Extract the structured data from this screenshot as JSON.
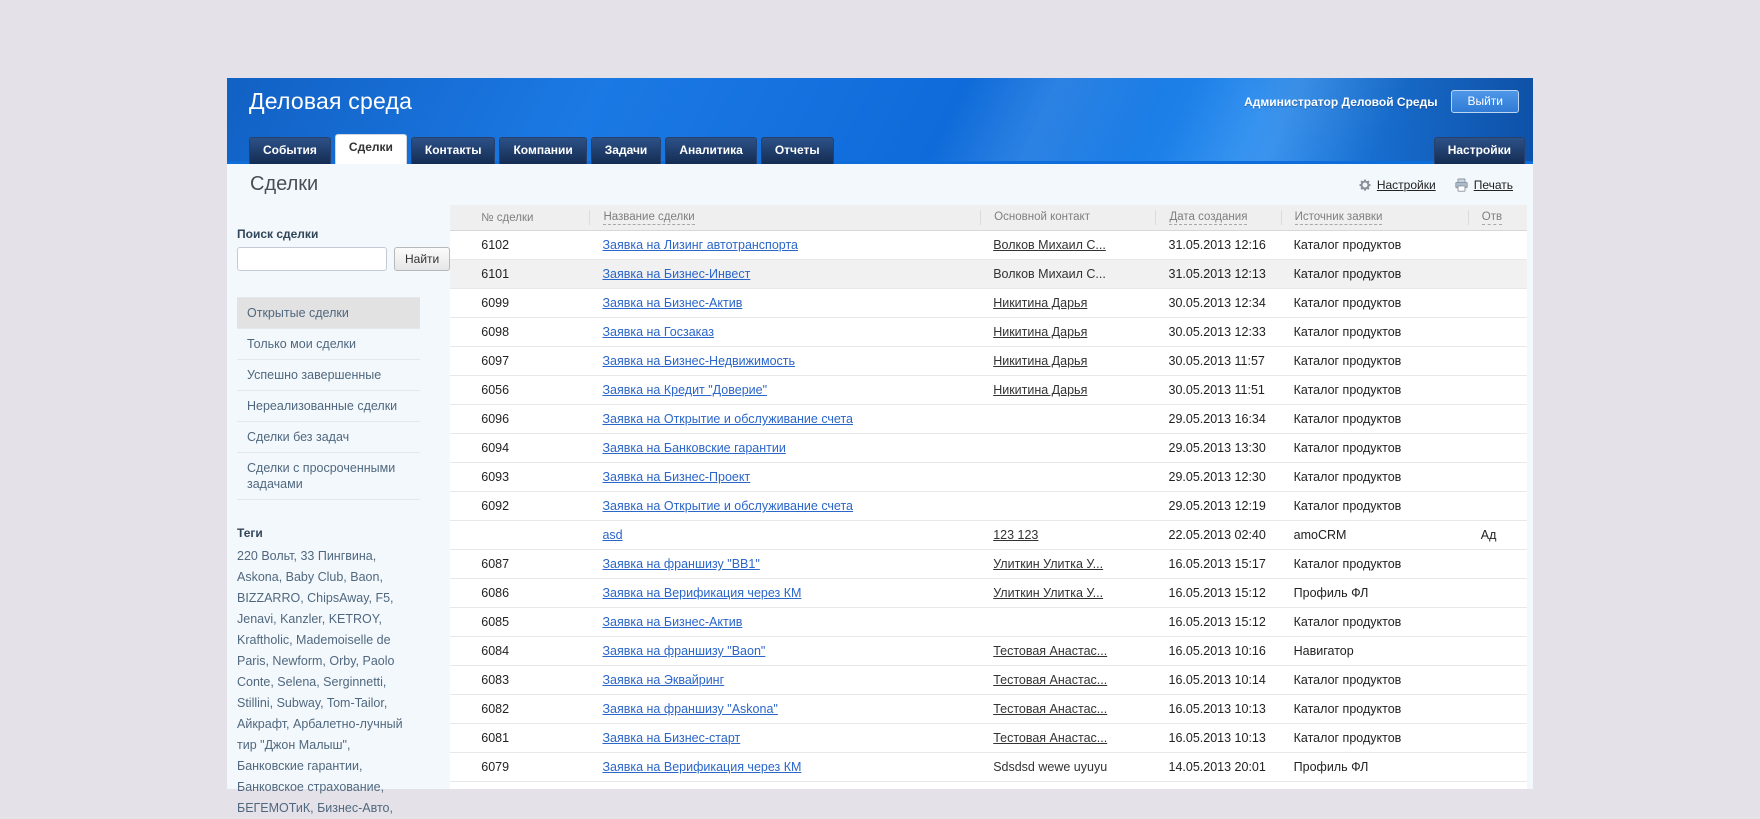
{
  "header": {
    "app_title": "Деловая среда",
    "user_name": "Администратор Деловой Среды",
    "logout_label": "Выйти",
    "tabs": [
      {
        "label": "События",
        "active": false
      },
      {
        "label": "Сделки",
        "active": true
      },
      {
        "label": "Контакты",
        "active": false
      },
      {
        "label": "Компании",
        "active": false
      },
      {
        "label": "Задачи",
        "active": false
      },
      {
        "label": "Аналитика",
        "active": false
      },
      {
        "label": "Отчеты",
        "active": false
      }
    ],
    "settings_tab_label": "Настройки"
  },
  "toolbar": {
    "page_title": "Сделки",
    "settings_link": "Настройки",
    "print_link": "Печать",
    "settings_icon": "gear-icon",
    "print_icon": "printer-icon"
  },
  "sidebar": {
    "search_label": "Поиск сделки",
    "search_value": "",
    "search_button": "Найти",
    "filters": [
      {
        "label": "Открытые сделки",
        "active": true
      },
      {
        "label": "Только мои сделки",
        "active": false
      },
      {
        "label": "Успешно завершенные",
        "active": false
      },
      {
        "label": "Нереализованные сделки",
        "active": false
      },
      {
        "label": "Сделки без задач",
        "active": false
      },
      {
        "label": "Сделки с просроченными задачами",
        "active": false
      }
    ],
    "tags_title": "Теги",
    "tags_text": "220 Вольт, 33 Пингвина, Askona, Baby Club, Baon, BIZZARRO, ChipsAway, F5, Jenavi, Kanzler, KETROY, Kraftholic, Mademoiselle de Paris, Newform, Orby, Paolo Conte, Selena, Serginnetti, Stillini, Subway, Tom-Tailor, Айкрафт, Арбалетно-лучный тир \"Джон Малыш\", Банковские гарантии, Банковское страхование, БЕГЕМОТиК, Бизнес-Авто,"
  },
  "table": {
    "columns": [
      {
        "label": "№ сделки",
        "sortable": false
      },
      {
        "label": "Название сделки",
        "sortable": true
      },
      {
        "label": "Основной контакт",
        "sortable": false
      },
      {
        "label": "Дата создания",
        "sortable": true
      },
      {
        "label": "Источник заявки",
        "sortable": true
      },
      {
        "label": "Отв",
        "sortable": true
      }
    ],
    "rows": [
      {
        "id": "6102",
        "name": "Заявка на Лизинг автотранспорта",
        "contact": "Волков Михаил С...",
        "contact_is_link": true,
        "date": "31.05.2013 12:16",
        "source": "Каталог продуктов",
        "responsible": "",
        "highlighted": false
      },
      {
        "id": "6101",
        "name": "Заявка на Бизнес-Инвест",
        "contact": "Волков Михаил С...",
        "contact_is_link": false,
        "date": "31.05.2013 12:13",
        "source": "Каталог продуктов",
        "responsible": "",
        "highlighted": true
      },
      {
        "id": "6099",
        "name": "Заявка на Бизнес-Актив",
        "contact": "Никитина Дарья",
        "contact_is_link": true,
        "date": "30.05.2013 12:34",
        "source": "Каталог продуктов",
        "responsible": "",
        "highlighted": false
      },
      {
        "id": "6098",
        "name": "Заявка на Госзаказ",
        "contact": "Никитина Дарья",
        "contact_is_link": true,
        "date": "30.05.2013 12:33",
        "source": "Каталог продуктов",
        "responsible": "",
        "highlighted": false
      },
      {
        "id": "6097",
        "name": "Заявка на Бизнес-Недвижимость",
        "contact": "Никитина Дарья",
        "contact_is_link": true,
        "date": "30.05.2013 11:57",
        "source": "Каталог продуктов",
        "responsible": "",
        "highlighted": false
      },
      {
        "id": "6056",
        "name": "Заявка на Кредит \"Доверие\"",
        "contact": "Никитина Дарья",
        "contact_is_link": true,
        "date": "30.05.2013 11:51",
        "source": "Каталог продуктов",
        "responsible": "",
        "highlighted": false
      },
      {
        "id": "6096",
        "name": "Заявка на Открытие и обслуживание счета",
        "contact": "",
        "contact_is_link": false,
        "date": "29.05.2013 16:34",
        "source": "Каталог продуктов",
        "responsible": "",
        "highlighted": false
      },
      {
        "id": "6094",
        "name": "Заявка на Банковские гарантии",
        "contact": "",
        "contact_is_link": false,
        "date": "29.05.2013 13:30",
        "source": "Каталог продуктов",
        "responsible": "",
        "highlighted": false
      },
      {
        "id": "6093",
        "name": "Заявка на Бизнес-Проект",
        "contact": "",
        "contact_is_link": false,
        "date": "29.05.2013 12:30",
        "source": "Каталог продуктов",
        "responsible": "",
        "highlighted": false
      },
      {
        "id": "6092",
        "name": "Заявка на Открытие и обслуживание счета",
        "contact": "",
        "contact_is_link": false,
        "date": "29.05.2013 12:19",
        "source": "Каталог продуктов",
        "responsible": "",
        "highlighted": false
      },
      {
        "id": "",
        "name": "asd",
        "contact": "123 123",
        "contact_is_link": true,
        "date": "22.05.2013 02:40",
        "source": "amoCRM",
        "responsible": "Ад",
        "highlighted": false
      },
      {
        "id": "6087",
        "name": "Заявка на франшизу \"ВВ1\"",
        "contact": "Улиткин Улитка У...",
        "contact_is_link": true,
        "date": "16.05.2013 15:17",
        "source": "Каталог продуктов",
        "responsible": "",
        "highlighted": false
      },
      {
        "id": "6086",
        "name": "Заявка на Верификация через КМ",
        "contact": "Улиткин Улитка У...",
        "contact_is_link": true,
        "date": "16.05.2013 15:12",
        "source": "Профиль ФЛ",
        "responsible": "",
        "highlighted": false
      },
      {
        "id": "6085",
        "name": "Заявка на Бизнес-Актив",
        "contact": "",
        "contact_is_link": false,
        "date": "16.05.2013 15:12",
        "source": "Каталог продуктов",
        "responsible": "",
        "highlighted": false
      },
      {
        "id": "6084",
        "name": "Заявка на франшизу \"Baon\"",
        "contact": "Тестовая Анастас...",
        "contact_is_link": true,
        "date": "16.05.2013 10:16",
        "source": "Навигатор",
        "responsible": "",
        "highlighted": false
      },
      {
        "id": "6083",
        "name": "Заявка на Эквайринг",
        "contact": "Тестовая Анастас...",
        "contact_is_link": true,
        "date": "16.05.2013 10:14",
        "source": "Каталог продуктов",
        "responsible": "",
        "highlighted": false
      },
      {
        "id": "6082",
        "name": "Заявка на франшизу \"Askona\"",
        "contact": "Тестовая Анастас...",
        "contact_is_link": true,
        "date": "16.05.2013 10:13",
        "source": "Каталог продуктов",
        "responsible": "",
        "highlighted": false
      },
      {
        "id": "6081",
        "name": "Заявка на Бизнес-старт",
        "contact": "Тестовая Анастас...",
        "contact_is_link": true,
        "date": "16.05.2013 10:13",
        "source": "Каталог продуктов",
        "responsible": "",
        "highlighted": false
      },
      {
        "id": "6079",
        "name": "Заявка на Верификация через КМ",
        "contact": "Sdsdsd wewe uyuyu",
        "contact_is_link": false,
        "date": "14.05.2013 20:01",
        "source": "Профиль ФЛ",
        "responsible": "",
        "highlighted": false
      }
    ]
  },
  "colors": {
    "header_blue": "#1b79e4",
    "tab_dark": "#142c52",
    "accent_strip": "#0d6edb",
    "content_bg": "#f3f8fc",
    "link_blue": "#2b66c9",
    "sidebar_text": "#50687f",
    "page_bg": "#e4e2e8"
  }
}
